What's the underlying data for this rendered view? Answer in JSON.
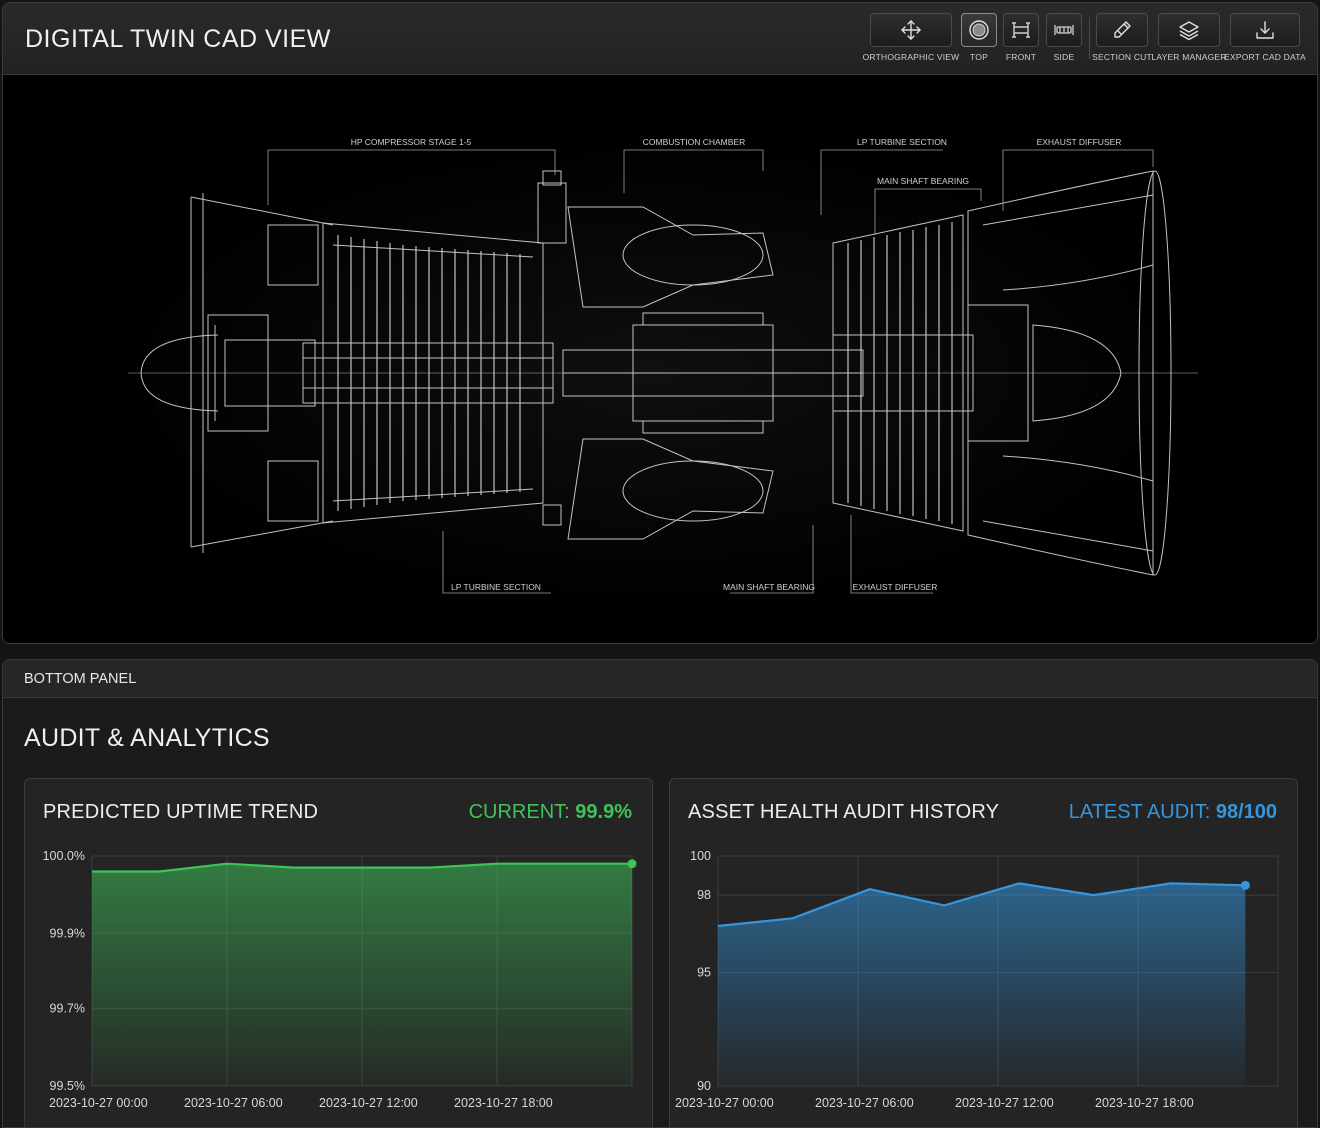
{
  "app": {
    "title": "DIGITAL TWIN CAD VIEW"
  },
  "toolbar": {
    "items": [
      {
        "label": "ORTHOGRAPHIC VIEW",
        "icon": "move-arrows-icon",
        "active": false
      },
      {
        "label": "TOP",
        "icon": "top-view-icon",
        "active": true
      },
      {
        "label": "FRONT",
        "icon": "front-view-icon",
        "active": false
      },
      {
        "label": "SIDE",
        "icon": "side-view-icon",
        "active": false
      },
      {
        "label": "SECTION CUT",
        "icon": "section-cut-icon",
        "active": false
      },
      {
        "label": "LAYER MANAGER",
        "icon": "layers-icon",
        "active": false
      },
      {
        "label": "EXPORT CAD DATA",
        "icon": "download-icon",
        "active": false
      }
    ]
  },
  "cad": {
    "callouts_top": [
      "HP COMPRESSOR STAGE 1-5",
      "COMBUSTION CHAMBER",
      "LP TURBINE SECTION",
      "MAIN SHAFT BEARING",
      "EXHAUST DIFFUSER"
    ],
    "callouts_bottom": [
      "LP TURBINE SECTION",
      "MAIN SHAFT BEARING",
      "EXHAUST DIFFUSER"
    ]
  },
  "bottom_panel": {
    "header": "BOTTOM PANEL",
    "section_title": "AUDIT & ANALYTICS"
  },
  "uptime_card": {
    "title": "PREDICTED UPTIME TREND",
    "stat_label": "CURRENT:",
    "stat_value": "99.9%",
    "color": "#3fc25a"
  },
  "audit_card": {
    "title": "ASSET HEALTH AUDIT HISTORY",
    "stat_label": "LATEST AUDIT:",
    "stat_value": "98/100",
    "color": "#3596e0"
  },
  "chart_data": [
    {
      "type": "area",
      "title": "PREDICTED UPTIME TREND",
      "x_ticks": [
        "2023-10-27 00:00",
        "2023-10-27 06:00",
        "2023-10-27 12:00",
        "2023-10-27 18:00"
      ],
      "y_ticks": [
        "100.0%",
        "99.9%",
        "99.7%",
        "99.5%"
      ],
      "ylim": [
        99.5,
        100.0
      ],
      "x_hours": [
        0,
        3,
        6,
        9,
        12,
        15,
        18,
        21,
        24
      ],
      "values": [
        99.98,
        99.98,
        99.99,
        99.985,
        99.985,
        99.985,
        99.99,
        99.99,
        99.99
      ],
      "grid": true,
      "color": "#3fc25a"
    },
    {
      "type": "area",
      "title": "ASSET HEALTH AUDIT HISTORY",
      "x_ticks": [
        "2023-10-27 00:00",
        "2023-10-27 06:00",
        "2023-10-27 12:00",
        "2023-10-27 18:00"
      ],
      "y_ticks": [
        "100",
        "98",
        "95",
        "90"
      ],
      "ylim": [
        90,
        100
      ],
      "x_hours": [
        0,
        3.2,
        6.5,
        9.7,
        12.9,
        16.1,
        19.4,
        22.6
      ],
      "values": [
        96.8,
        97.1,
        98.3,
        97.6,
        98.6,
        98.0,
        98.6,
        98.5
      ],
      "grid": true,
      "color": "#3596e0"
    }
  ]
}
